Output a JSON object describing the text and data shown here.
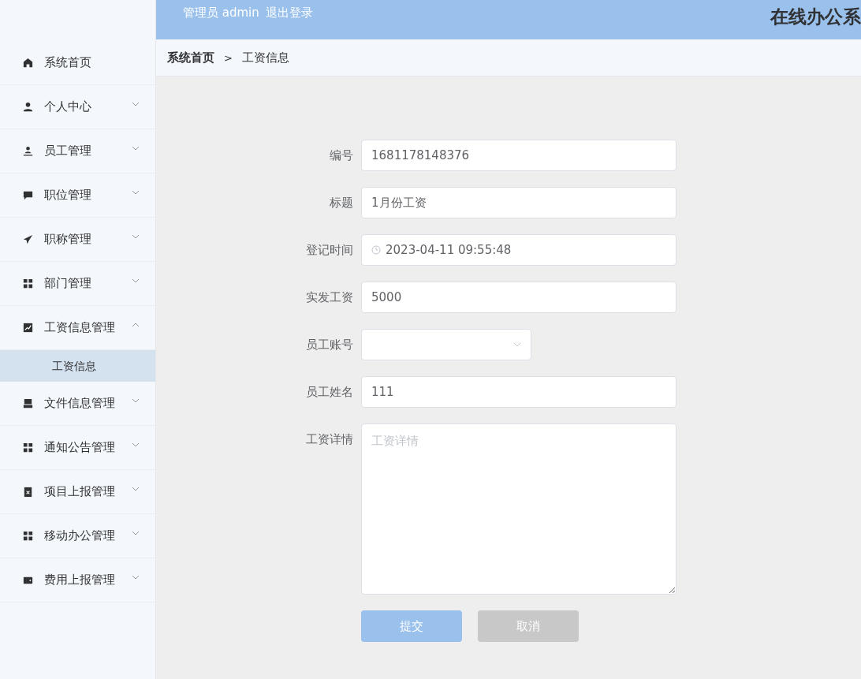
{
  "header": {
    "user_label": "管理员 admin",
    "logout": "退出登录",
    "title": "在线办公系"
  },
  "sidebar": {
    "items": [
      {
        "label": "系统首页",
        "kind": "link"
      },
      {
        "label": "个人中心",
        "kind": "menu",
        "expanded": false
      },
      {
        "label": "员工管理",
        "kind": "menu",
        "expanded": false
      },
      {
        "label": "职位管理",
        "kind": "menu",
        "expanded": false
      },
      {
        "label": "职称管理",
        "kind": "menu",
        "expanded": false
      },
      {
        "label": "部门管理",
        "kind": "menu",
        "expanded": false
      },
      {
        "label": "工资信息管理",
        "kind": "menu",
        "expanded": true,
        "children": [
          {
            "label": "工资信息",
            "selected": true
          }
        ]
      },
      {
        "label": "文件信息管理",
        "kind": "menu",
        "expanded": false
      },
      {
        "label": "通知公告管理",
        "kind": "menu",
        "expanded": false
      },
      {
        "label": "项目上报管理",
        "kind": "menu",
        "expanded": false
      },
      {
        "label": "移动办公管理",
        "kind": "menu",
        "expanded": false
      },
      {
        "label": "费用上报管理",
        "kind": "menu",
        "expanded": false
      }
    ]
  },
  "breadcrumb": {
    "home": "系统首页",
    "separator": ">",
    "current": "工资信息"
  },
  "form": {
    "fields": [
      {
        "label": "编号",
        "kind": "text",
        "value": "1681178148376"
      },
      {
        "label": "标题",
        "kind": "text",
        "value": "1月份工资"
      },
      {
        "label": "登记时间",
        "kind": "datetime",
        "value": "2023-04-11 09:55:48"
      },
      {
        "label": "实发工资",
        "kind": "text",
        "value": "5000"
      },
      {
        "label": "员工账号",
        "kind": "select"
      },
      {
        "label": "员工姓名",
        "kind": "text",
        "value": "111"
      },
      {
        "label": "工资详情",
        "kind": "textarea",
        "placeholder": "工资详情"
      }
    ],
    "buttons": [
      {
        "label": "提交",
        "kind": "primary"
      },
      {
        "label": "取消",
        "kind": "cancel"
      }
    ]
  }
}
